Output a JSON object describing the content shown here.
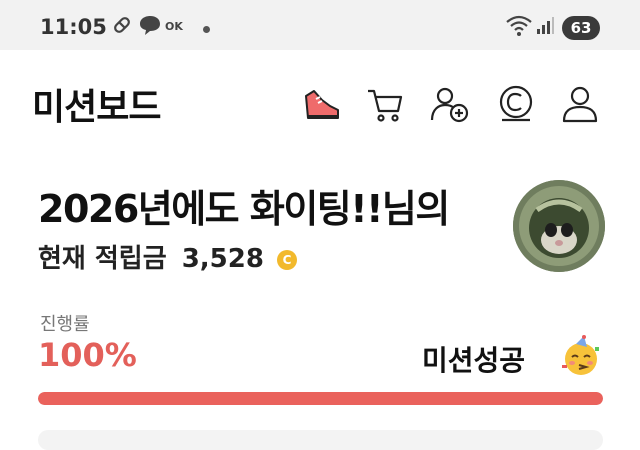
{
  "status_bar": {
    "time": "11:05",
    "ok_label": "OK",
    "battery": "63"
  },
  "header": {
    "title": "미션보드",
    "icons": [
      "shoe-icon",
      "cart-icon",
      "add-friend-icon",
      "coin-icon",
      "profile-icon"
    ]
  },
  "user": {
    "headline": "2026년에도 화이팅!!님의",
    "points_label": "현재 적립금",
    "points_value": "3,528",
    "coin_symbol": "C"
  },
  "progress": {
    "label": "진행률",
    "value_text": "100%",
    "fraction": 1.0,
    "status_text": "미션성공",
    "bar_color": "#ea625c",
    "value_color": "#e3605a"
  }
}
